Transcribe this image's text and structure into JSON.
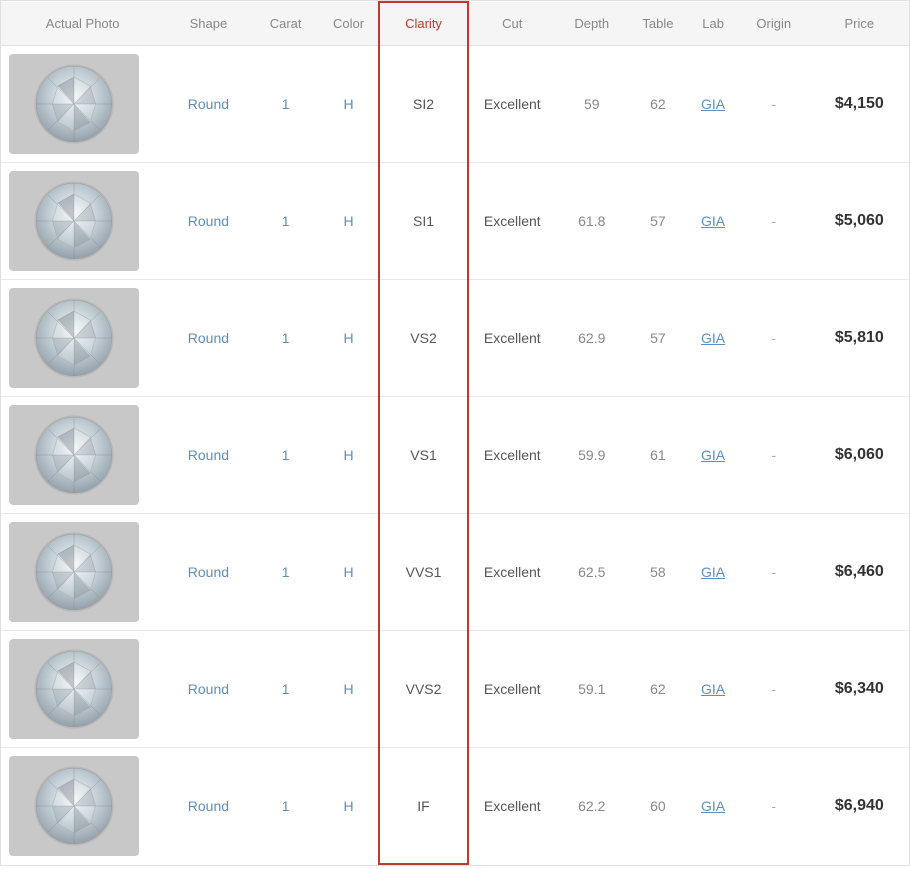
{
  "header": {
    "actual_photo": "Actual Photo",
    "shape": "Shape",
    "carat": "Carat",
    "color": "Color",
    "clarity": "Clarity",
    "cut": "Cut",
    "depth": "Depth",
    "table": "Table",
    "lab": "Lab",
    "origin": "Origin",
    "price": "Price"
  },
  "rows": [
    {
      "shape": "Round",
      "carat": "1",
      "color": "H",
      "clarity": "SI2",
      "cut": "Excellent",
      "depth": "59",
      "table": "62",
      "lab": "GIA",
      "origin": "-",
      "price": "$4,150"
    },
    {
      "shape": "Round",
      "carat": "1",
      "color": "H",
      "clarity": "SI1",
      "cut": "Excellent",
      "depth": "61.8",
      "table": "57",
      "lab": "GIA",
      "origin": "-",
      "price": "$5,060"
    },
    {
      "shape": "Round",
      "carat": "1",
      "color": "H",
      "clarity": "VS2",
      "cut": "Excellent",
      "depth": "62.9",
      "table": "57",
      "lab": "GIA",
      "origin": "-",
      "price": "$5,810"
    },
    {
      "shape": "Round",
      "carat": "1",
      "color": "H",
      "clarity": "VS1",
      "cut": "Excellent",
      "depth": "59.9",
      "table": "61",
      "lab": "GIA",
      "origin": "-",
      "price": "$6,060"
    },
    {
      "shape": "Round",
      "carat": "1",
      "color": "H",
      "clarity": "VVS1",
      "cut": "Excellent",
      "depth": "62.5",
      "table": "58",
      "lab": "GIA",
      "origin": "-",
      "price": "$6,460"
    },
    {
      "shape": "Round",
      "carat": "1",
      "color": "H",
      "clarity": "VVS2",
      "cut": "Excellent",
      "depth": "59.1",
      "table": "62",
      "lab": "GIA",
      "origin": "-",
      "price": "$6,340"
    },
    {
      "shape": "Round",
      "carat": "1",
      "color": "H",
      "clarity": "IF",
      "cut": "Excellent",
      "depth": "62.2",
      "table": "60",
      "lab": "GIA",
      "origin": "-",
      "price": "$6,940"
    }
  ]
}
